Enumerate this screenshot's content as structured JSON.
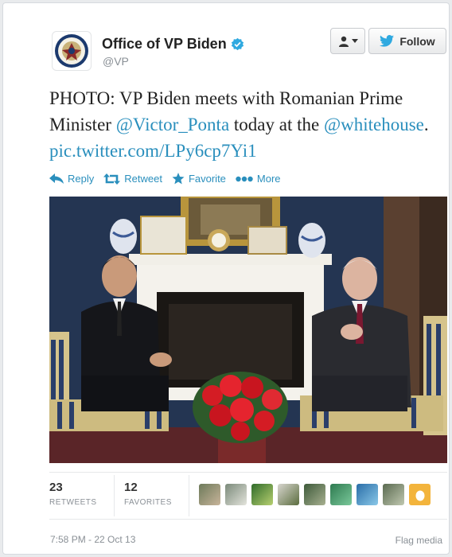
{
  "account": {
    "name": "Office of VP Biden",
    "handle": "@VP",
    "avatar_icon": "vp-seal-icon",
    "verified_icon": "verified-badge-icon"
  },
  "buttons": {
    "user_menu_icon": "person-icon",
    "follow_label": "Follow",
    "follow_icon": "twitter-bird-icon"
  },
  "tweet": {
    "text_part1": "PHOTO: VP Biden meets with Romanian Prime Minister ",
    "mention1": "@Victor_Ponta",
    "text_part2": " today at the ",
    "mention2": "@whitehouse",
    "text_part3": ". ",
    "link": "pic.twitter.com/LPy6cp7Yi1"
  },
  "actions": [
    {
      "label": "Reply",
      "icon": "reply-icon"
    },
    {
      "label": "Retweet",
      "icon": "retweet-icon"
    },
    {
      "label": "Favorite",
      "icon": "star-icon"
    },
    {
      "label": "More",
      "icon": "more-dots-icon"
    }
  ],
  "stats": {
    "retweets_count": "23",
    "retweets_label": "RETWEETS",
    "favorites_count": "12",
    "favorites_label": "FAVORITES"
  },
  "favoriter_avatars_count": 9,
  "timestamp": "7:58 PM - 22 Oct 13",
  "flag_media": "Flag media",
  "colors": {
    "link": "#2a8fbd",
    "text": "#222222",
    "muted": "#8a9096",
    "verified": "#2fa9e0"
  }
}
